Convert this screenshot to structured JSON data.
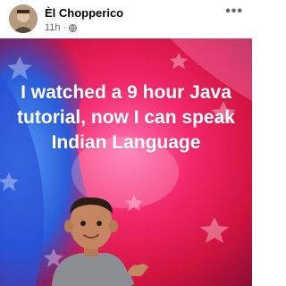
{
  "post": {
    "author": "Èl Chopperico",
    "timestamp": "11h",
    "separator": "·",
    "privacy_icon": "globe-icon",
    "more_icon": "more-options-icon",
    "more_label": "•••",
    "text": "I watched a 9 hour Java tutorial, now I can speak Indian Language"
  },
  "colors": {
    "background_red": "#e8164a",
    "background_blue": "#1f5fe0",
    "text": "#ffffff",
    "author": "#050505",
    "meta": "#65676b"
  }
}
